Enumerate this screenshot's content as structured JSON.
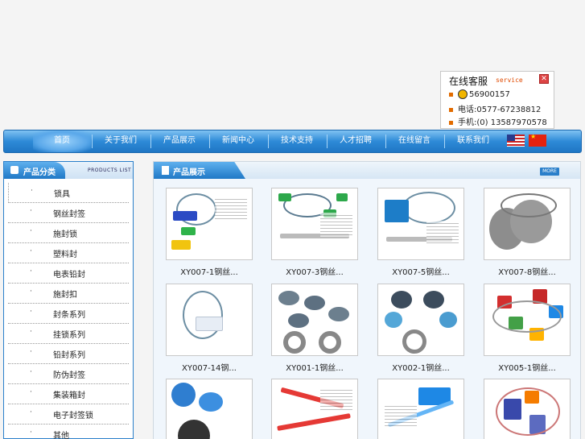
{
  "service": {
    "title": "在线客服",
    "subtitle": "service",
    "close": "✕",
    "qq": "56900157",
    "tel": "电话:0577-67238812",
    "mobile": "手机:(0) 13587970578"
  },
  "nav": {
    "items": [
      "首页",
      "关于我们",
      "产品展示",
      "新闻中心",
      "技术支持",
      "人才招聘",
      "在线留言",
      "联系我们"
    ],
    "active_index": 0
  },
  "sidebar": {
    "title": "产品分类",
    "subtitle": "PRODUCTS LIST",
    "bullet": "·",
    "items": [
      "锁具",
      "钢丝封签",
      "施封锁",
      "塑料封",
      "电表铅封",
      "施封扣",
      "封条系列",
      "挂锁系列",
      "铅封系列",
      "防伪封签",
      "集装箱封",
      "电子封签锁",
      "其他"
    ]
  },
  "main": {
    "title": "产品展示",
    "more": "MORE",
    "products": [
      {
        "caption": "XY007-1钢丝...",
        "theme": "wire-blue"
      },
      {
        "caption": "XY007-3钢丝...",
        "theme": "wire-green"
      },
      {
        "caption": "XY007-5钢丝...",
        "theme": "wire-block"
      },
      {
        "caption": "XY007-8钢丝...",
        "theme": "stone"
      },
      {
        "caption": "XY007-14钢...",
        "theme": "wire-loop"
      },
      {
        "caption": "XY001-1钢丝...",
        "theme": "rings"
      },
      {
        "caption": "XY002-1钢丝...",
        "theme": "disks"
      },
      {
        "caption": "XY005-1钢丝...",
        "theme": "colored"
      },
      {
        "caption": "",
        "theme": "blue-meter"
      },
      {
        "caption": "",
        "theme": "red-strap"
      },
      {
        "caption": "",
        "theme": "blue-strap"
      },
      {
        "caption": "",
        "theme": "tags"
      }
    ]
  },
  "colors": {
    "nav_blue": "#2d8ad7",
    "accent_orange": "#e26b00",
    "panel_border": "#2a7fca"
  }
}
